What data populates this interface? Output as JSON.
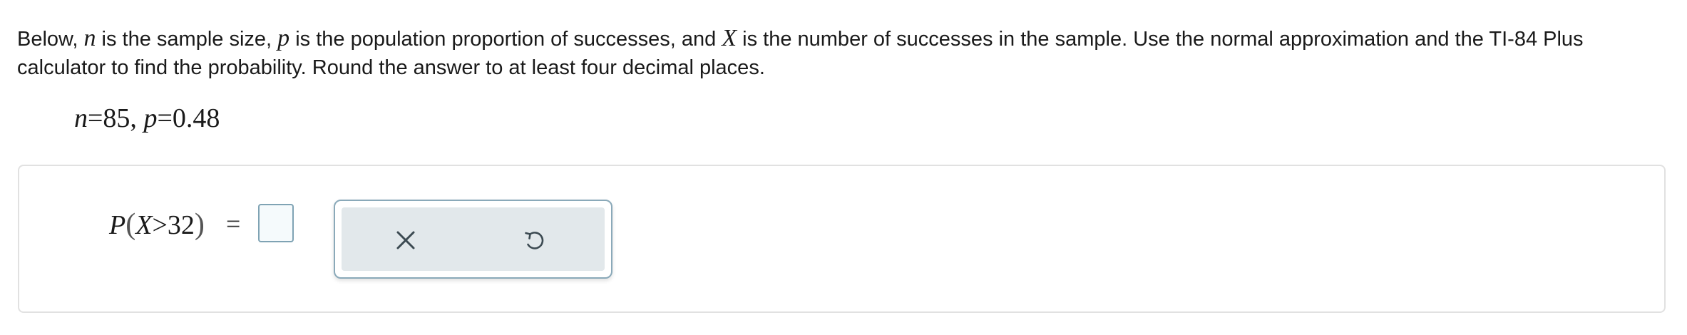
{
  "question": {
    "part1": "Below, ",
    "var_n": "n",
    "part2": " is the sample size, ",
    "var_p": "p",
    "part3": " is the population proportion of successes, and ",
    "var_x": "X",
    "part4": " is the number of successes in the sample. Use the normal approximation and the TI-84 Plus calculator to find the probability. Round the answer to at least four decimal places."
  },
  "given": {
    "n_symbol": "n",
    "n_eq": "=85, ",
    "p_symbol": "p",
    "p_eq": "=0.48"
  },
  "answer": {
    "p_symbol": "P",
    "open_paren": "(",
    "x_symbol": "X",
    "inequality": ">32",
    "close_paren": ")",
    "equals": "=",
    "value": ""
  },
  "tools": {
    "clear_icon": "close-icon",
    "undo_icon": "undo-icon"
  },
  "colors": {
    "answer_box_border": "#7fa3b4",
    "tool_frame_border": "#8aa9b9",
    "tool_background": "#e2e8eb",
    "icon_color": "#3c4a52"
  }
}
